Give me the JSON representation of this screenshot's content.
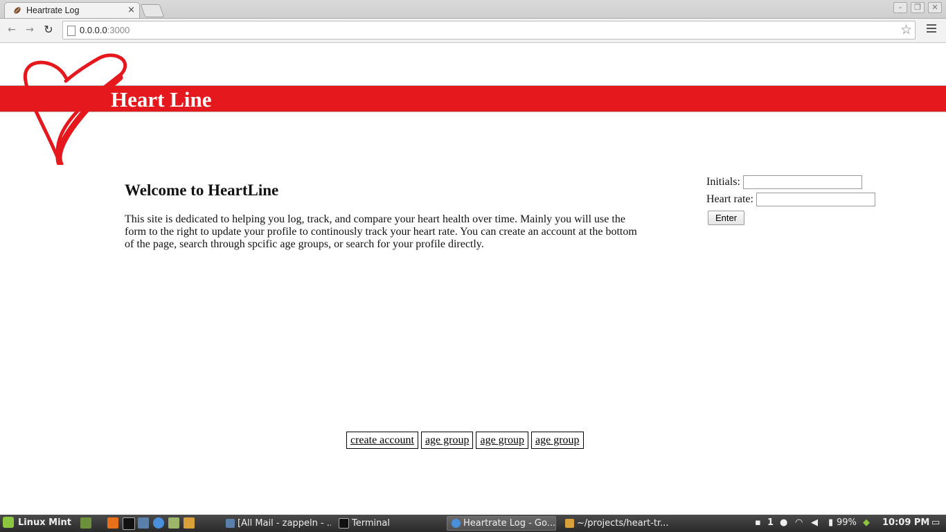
{
  "browser": {
    "tab_title": "Heartrate Log",
    "tab_close": "×",
    "url_host": "0.0.0.0",
    "url_port": ":3000",
    "back": "←",
    "forward": "→",
    "reload": "↻",
    "star": "☆",
    "win_minimize": "–",
    "win_restore": "❐",
    "win_close": "✕"
  },
  "page": {
    "site_title": "Heart Line",
    "welcome_heading": "Welcome to HeartLine",
    "intro": "This site is dedicated to helping you log, track, and compare your heart health over time. Mainly you will use the form to the right to update your profile to continously track your heart rate. You can create an account at the bottom of the page, search through spcific age groups, or search for your profile directly.",
    "form": {
      "initials_label": "Initials:",
      "initials_value": "",
      "heart_rate_label": "Heart rate:",
      "heart_rate_value": "",
      "enter_label": "Enter"
    },
    "links": [
      "create account",
      "age group",
      "age group",
      "age group"
    ]
  },
  "taskbar": {
    "menu_label": "Linux Mint",
    "tasks": [
      {
        "label": "[All Mail - zappeln - ...",
        "active": false
      },
      {
        "label": "Terminal",
        "active": false
      },
      {
        "label": "Heartrate Log - Go...",
        "active": true
      },
      {
        "label": "~/projects/heart-tr...",
        "active": false
      }
    ],
    "tray": {
      "notifications": "1",
      "battery": "99%",
      "clock": "10:09 PM"
    }
  },
  "colors": {
    "banner": "#e5191d",
    "heart": "#e5191d"
  }
}
